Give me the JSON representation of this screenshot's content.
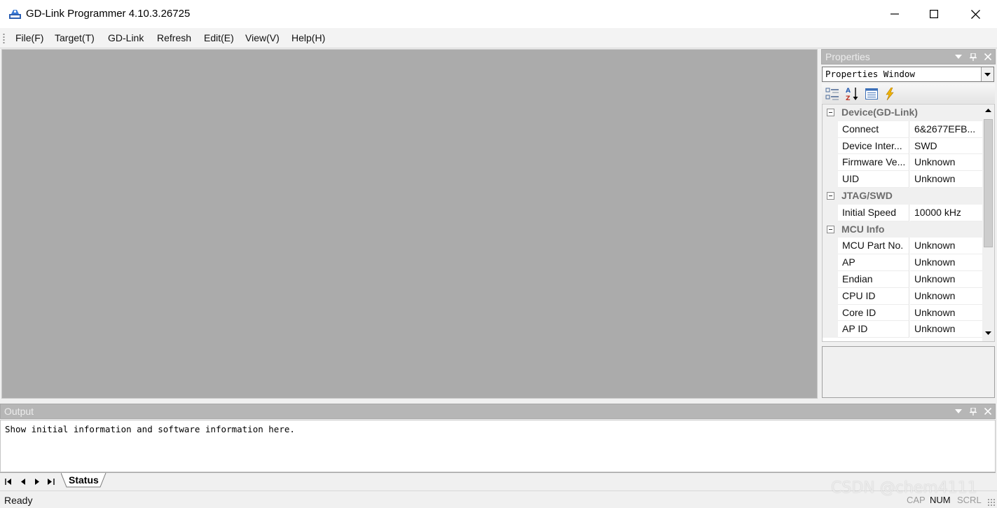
{
  "window": {
    "title": "GD-Link Programmer 4.10.3.26725",
    "controls": [
      "minimize-icon",
      "maximize-icon",
      "close-icon"
    ]
  },
  "menu": {
    "items": [
      "File(F)",
      "Target(T)",
      "GD-Link",
      "Refresh",
      "Edit(E)",
      "View(V)",
      "Help(H)"
    ]
  },
  "properties": {
    "title": "Properties",
    "selector_value": "Properties Window",
    "toolbar_icons": [
      "categorized-icon",
      "alphabetical-sort-icon",
      "property-pages-icon",
      "events-icon"
    ],
    "categories": [
      {
        "label": "Device(GD-Link)",
        "rows": [
          {
            "name": "Connect",
            "value": "6&2677EFB..."
          },
          {
            "name": "Device Inter...",
            "value": "SWD"
          },
          {
            "name": "Firmware Ve...",
            "value": "Unknown"
          },
          {
            "name": "UID",
            "value": "Unknown"
          }
        ]
      },
      {
        "label": "JTAG/SWD",
        "rows": [
          {
            "name": "Initial Speed",
            "value": "10000 kHz"
          }
        ]
      },
      {
        "label": "MCU Info",
        "rows": [
          {
            "name": "MCU Part No.",
            "value": "Unknown"
          },
          {
            "name": "AP",
            "value": "Unknown"
          },
          {
            "name": "Endian",
            "value": "Unknown"
          },
          {
            "name": "CPU ID",
            "value": "Unknown"
          },
          {
            "name": "Core ID",
            "value": "Unknown"
          },
          {
            "name": "AP ID",
            "value": "Unknown"
          }
        ]
      }
    ]
  },
  "output": {
    "title": "Output",
    "text": "Show initial information and software information here.",
    "tab_label": "Status"
  },
  "statusbar": {
    "text": "Ready",
    "indicators": [
      "CAP",
      "NUM",
      "SCRL"
    ],
    "watermark": "CSDN @chem4111"
  },
  "colors": {
    "workspace": "#ababab",
    "pane_header": "#b6b6b6",
    "category_text": "#6d6d6d"
  }
}
